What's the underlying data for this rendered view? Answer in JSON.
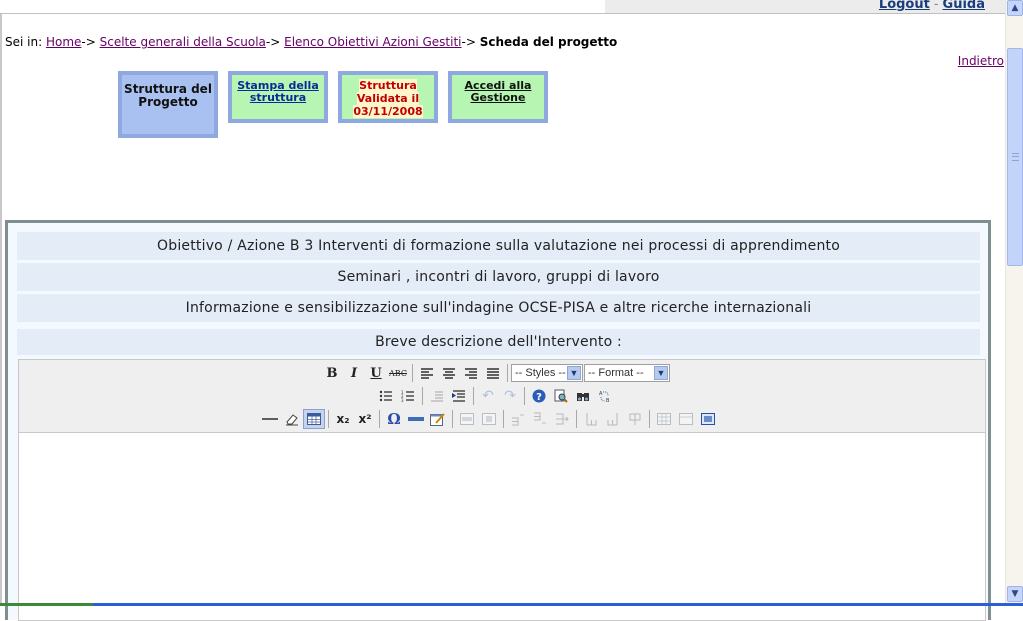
{
  "header": {
    "logout_label": "Logout",
    "separator": "-",
    "help_label": "Guida"
  },
  "breadcrumb": {
    "prefix": "Sei in:",
    "items": [
      {
        "label": "Home"
      },
      {
        "label": "Scelte generali della Scuola"
      },
      {
        "label": "Elenco Obiettivi Azioni Gestiti"
      }
    ],
    "arrow": "->",
    "current": "Scheda del progetto"
  },
  "back_label": "Indietro",
  "tabs": {
    "structure": {
      "line1": "Struttura del",
      "line2": "Progetto"
    },
    "print": {
      "line1": "Stampa della",
      "line2": "struttura"
    },
    "validated": {
      "line1": "Struttura",
      "line2": "Validata il",
      "date": "03/11/2008"
    },
    "access": {
      "line1": "Accedi alla",
      "line2": "Gestione"
    }
  },
  "panel": {
    "objective": "Obiettivo / Azione B 3 Interventi di formazione sulla valutazione nei processi di apprendimento",
    "activity_type": "Seminari , incontri di lavoro, gruppi di lavoro",
    "title": "Informazione e sensibilizzazione sull'indagine OCSE-PISA e altre ricerche internazionali",
    "description_label": "Breve descrizione dell'Intervento :"
  },
  "editor": {
    "styles_select": "-- Styles --",
    "format_select": "-- Format --",
    "content": "",
    "buttons": {
      "bold": "B",
      "italic": "I",
      "underline": "U",
      "strike": "ABC",
      "subscript": "x₂",
      "superscript": "x²",
      "charmap": "Ω"
    }
  },
  "colors": {
    "tab_active_bg": "#a9c1f0",
    "tab_bg": "#b6f5b2",
    "tab_border": "#8fa9e0",
    "validated_text": "#c00000",
    "row_bg": "#e4ecf8",
    "visited_link": "#660066"
  }
}
